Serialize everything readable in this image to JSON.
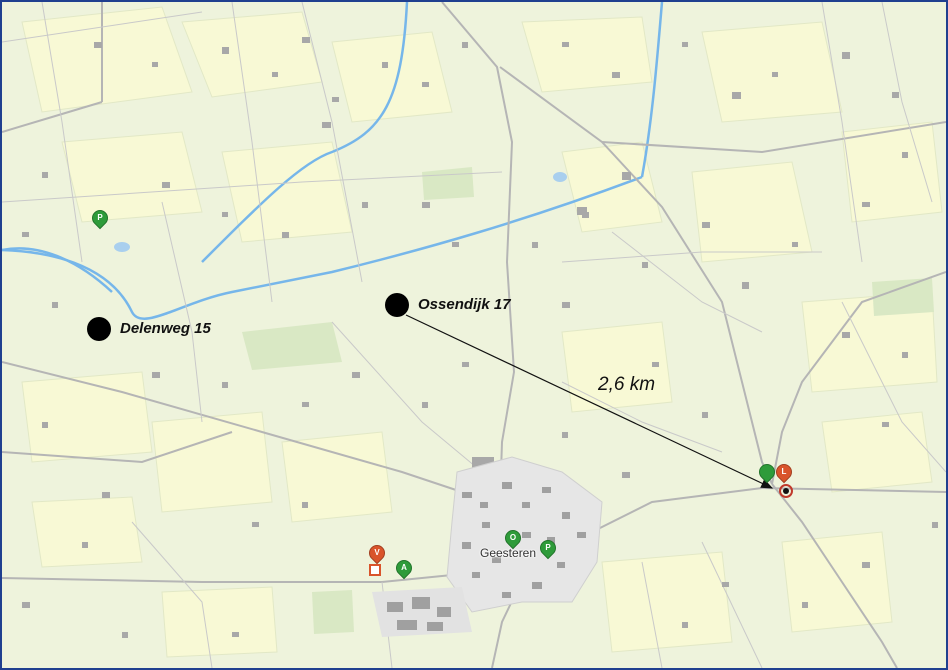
{
  "map": {
    "town": "Geesteren",
    "colors": {
      "background": "#eef3dc",
      "field": "#f8f9d5",
      "road": "#a9a9a9",
      "water": "#76b6ea",
      "building": "#a8a8a8",
      "green_pin": "#2e9b3a",
      "red_pin": "#d9542b",
      "frame": "#1f3f8f"
    }
  },
  "markers": [
    {
      "id": "delenweg",
      "label": "Delenweg 15"
    },
    {
      "id": "ossendijk",
      "label": "Ossendijk 17"
    }
  ],
  "distance": {
    "label": "2,6 km"
  },
  "pins": [
    {
      "letter": "P",
      "color": "green"
    },
    {
      "letter": "V",
      "color": "red"
    },
    {
      "letter": "A",
      "color": "green"
    },
    {
      "letter": "O",
      "color": "green"
    },
    {
      "letter": "P",
      "color": "green"
    },
    {
      "letter": "L",
      "color": "red"
    },
    {
      "letter": "",
      "color": "green"
    }
  ]
}
